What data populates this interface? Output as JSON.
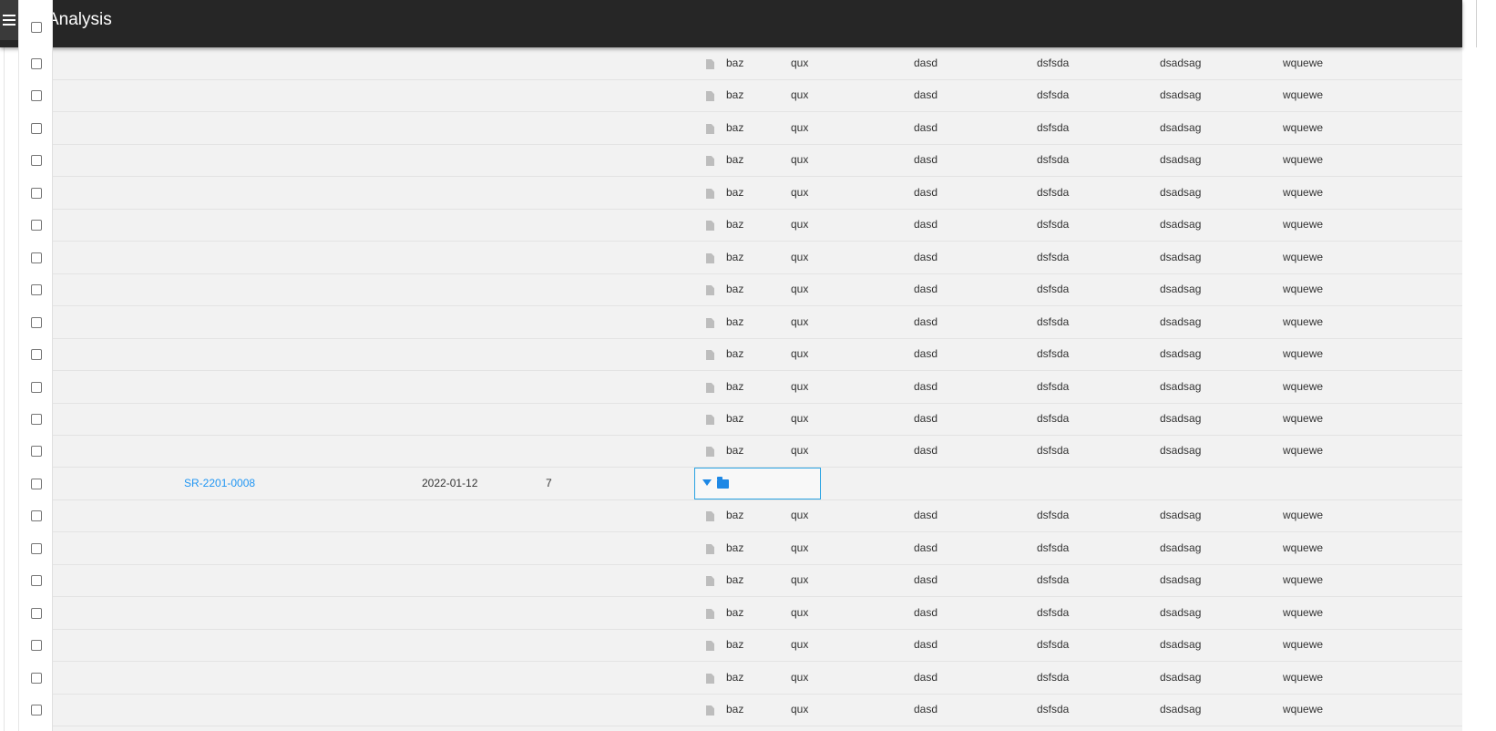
{
  "app": {
    "title": "Analysis"
  },
  "file_row": {
    "c1": "baz",
    "c2": "qux",
    "c3": "dasd",
    "c4": "dsfsda",
    "c5": "dsadsag",
    "c6": "wquewe"
  },
  "group": {
    "id": "SR-2201-0008",
    "date": "2022-01-12",
    "count": "7"
  },
  "layout_rows": [
    "file",
    "file",
    "file",
    "file",
    "file",
    "file",
    "file",
    "file",
    "file",
    "file",
    "file",
    "file",
    "file",
    "group",
    "file",
    "file",
    "file",
    "file",
    "file",
    "file",
    "file"
  ],
  "icons": {
    "menu": "hamburger-menu-icon",
    "file": "file-icon",
    "expand": "triangle-down-icon",
    "folder": "folder-icon"
  },
  "colors": {
    "appbar": "#262626",
    "link": "#2196f3",
    "accent": "#29a3e3",
    "row_bg": "#f2f2f2"
  }
}
